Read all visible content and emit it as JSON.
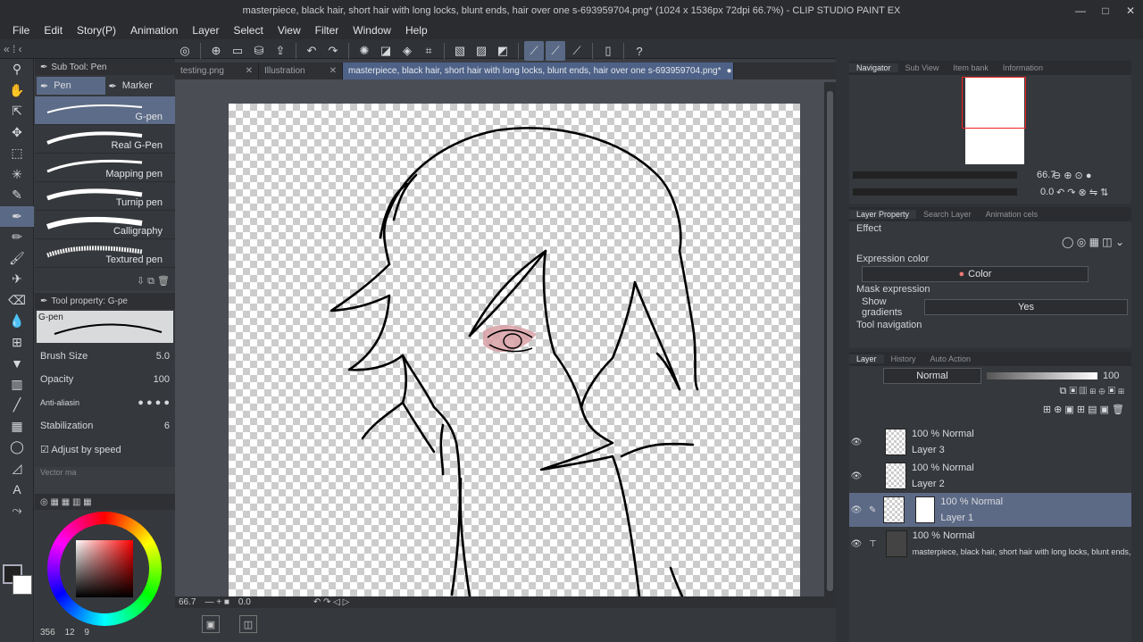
{
  "window": {
    "title": "masterpiece, black hair, short hair with long locks, blunt ends, hair over one  s-693959704.png* (1024 x 1536px 72dpi 66.7%) - CLIP STUDIO PAINT EX",
    "minimize": "—",
    "maximize": "□",
    "close": "✕"
  },
  "menu": [
    "File",
    "Edit",
    "Story(P)",
    "Animation",
    "Layer",
    "Select",
    "View",
    "Filter",
    "Window",
    "Help"
  ],
  "subtool": {
    "header": "Sub Tool: Pen",
    "tabs": [
      "Pen",
      "Marker"
    ],
    "pens": [
      "G-pen",
      "Real G-Pen",
      "Mapping pen",
      "Turnip pen",
      "Calligraphy",
      "Textured pen"
    ]
  },
  "toolprop": {
    "header": "Tool property: G-pe",
    "preview_label": "G-pen",
    "brush_size_label": "Brush Size",
    "brush_size_value": "5.0",
    "opacity_label": "Opacity",
    "opacity_value": "100",
    "antialias_label": "Anti-aliasin",
    "stabilization_label": "Stabilization",
    "stabilization_value": "6",
    "adjust_label": "Adjust by speed",
    "vector_label": "Vector ma"
  },
  "color": {
    "main": "#8b1a1f",
    "readout": [
      "356",
      "12",
      "9"
    ]
  },
  "doc_tabs": [
    {
      "label": "testing.png"
    },
    {
      "label": "Illustration"
    },
    {
      "label": "masterpiece, black hair, short hair with long locks, blunt ends, hair over one  s-693959704.png*"
    }
  ],
  "status": {
    "zoom": "66.7",
    "angle": "0.0"
  },
  "navigator": {
    "tabs": [
      "Navigator",
      "Sub View",
      "Item bank",
      "Information"
    ],
    "zoom": "66.7",
    "rotation": "0.0"
  },
  "layer_property": {
    "tabs": [
      "Layer Property",
      "Search Layer",
      "Animation cels"
    ],
    "effect": "Effect",
    "expression_color": "Expression color",
    "color_value": "Color",
    "mask_expression": "Mask expression",
    "show_gradients": "Show gradients",
    "show_gradients_value": "Yes",
    "tool_navigation": "Tool navigation"
  },
  "layers_panel": {
    "tabs": [
      "Layer",
      "History",
      "Auto Action"
    ],
    "blend": "Normal",
    "opacity": "100",
    "layers": [
      {
        "mode": "100 % Normal",
        "name": "Layer 3"
      },
      {
        "mode": "100 % Normal",
        "name": "Layer 2"
      },
      {
        "mode": "100 % Normal",
        "name": "Layer 1"
      },
      {
        "mode": "100 % Normal",
        "name": "masterpiece, black hair, short hair with long locks, blunt ends, hair over o"
      }
    ]
  }
}
